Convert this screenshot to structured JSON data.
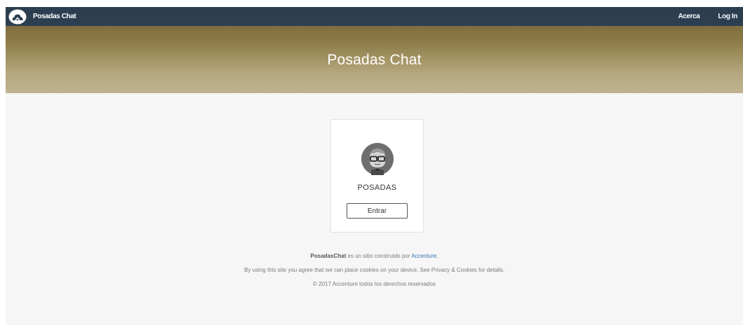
{
  "navbar": {
    "brand_name": "Posadas Chat",
    "brand_icon": "cloud-logo-icon",
    "links": [
      {
        "label": "Acerca"
      },
      {
        "label": "Log In"
      }
    ],
    "background_color": "#2c3e50"
  },
  "hero": {
    "title": "Posadas Chat",
    "gradient_top": "#7f6d3e",
    "gradient_bottom": "#c0b491"
  },
  "bot_card": {
    "avatar_icon": "bot-avatar-icon",
    "name": "POSADAS",
    "enter_button_label": "Entrar"
  },
  "footer": {
    "site_name": "PosadasChat",
    "built_by_text": " es un sitio construido por ",
    "company_link": "Accenture",
    "period": ".",
    "cookies_notice": "By using this site you agree that we can place cookies on your device. See Privacy & Cookies for details.",
    "copyright": "© 2017 Accenture todos los derechos reservados",
    "link_color": "#3b6fb6"
  }
}
